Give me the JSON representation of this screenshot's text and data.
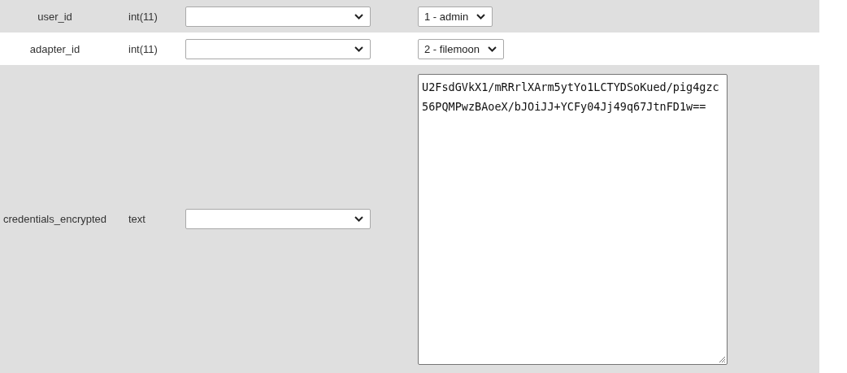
{
  "rows": [
    {
      "name": "user_id",
      "type": "int(11)",
      "function": "",
      "value": {
        "kind": "select",
        "text": "1 - admin"
      }
    },
    {
      "name": "adapter_id",
      "type": "int(11)",
      "function": "",
      "value": {
        "kind": "select",
        "text": "2 - filemoon"
      }
    },
    {
      "name": "credentials_encrypted",
      "type": "text",
      "function": "",
      "value": {
        "kind": "textarea",
        "text": "U2FsdGVkX1/mRRrlXArm5ytYo1LCTYDSoKued/pig4gzc56PQMPwzBAoeX/bJOiJJ+YCFy04Jj49q67JtnFD1w=="
      }
    }
  ]
}
